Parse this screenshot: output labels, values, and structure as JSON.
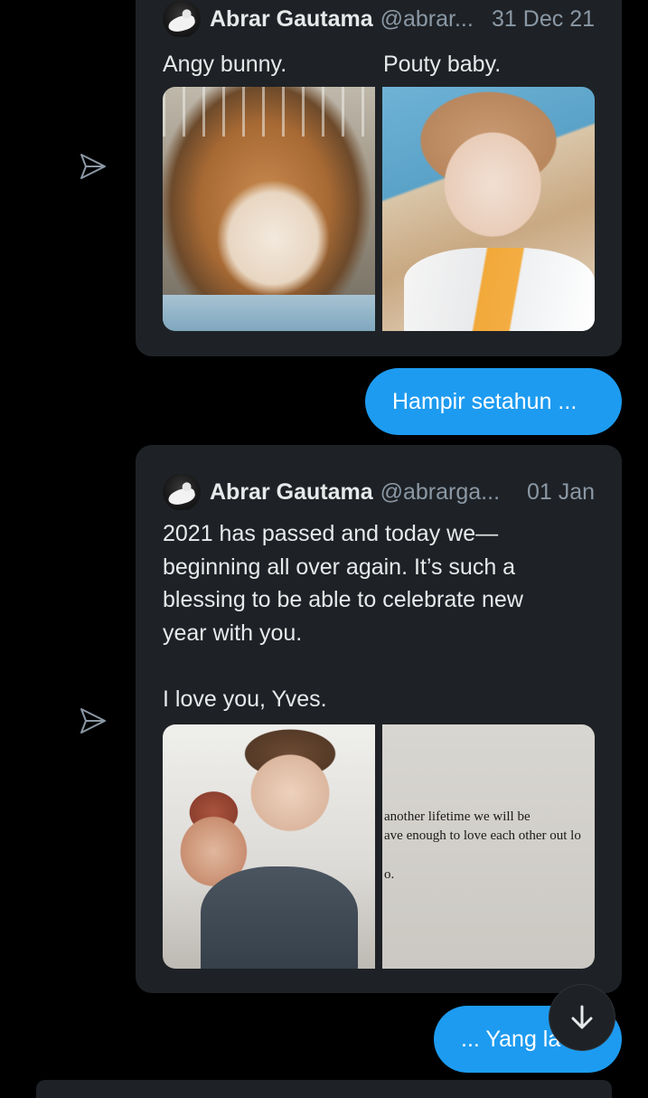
{
  "messages": [
    {
      "author_name": "Abrar Gautama",
      "author_handle": "@abrar...",
      "date": "31 Dec 21",
      "caption_left": "Angy bunny.",
      "caption_right": "Pouty baby."
    },
    {
      "bubble_text": "Hampir setahun ..."
    },
    {
      "author_name": "Abrar Gautama",
      "author_handle": "@abrarga...",
      "date": "01 Jan",
      "text": "2021 has passed and today we—\nbeginning all over again. It’s such a\nblessing to be able to celebrate new\nyear with you.\n\nI love you, Yves.",
      "paper_line_1": "another lifetime we will be",
      "paper_line_2": "ave enough to love each other out lo",
      "paper_line_3": "o."
    },
    {
      "bubble_text": "... Yang la"
    }
  ],
  "icons": {
    "share": "send-icon",
    "scroll": "arrow-down-icon"
  },
  "colors": {
    "background": "#000000",
    "card": "#1e2226",
    "accent": "#1d9bf0",
    "muted": "#8b98a5"
  }
}
